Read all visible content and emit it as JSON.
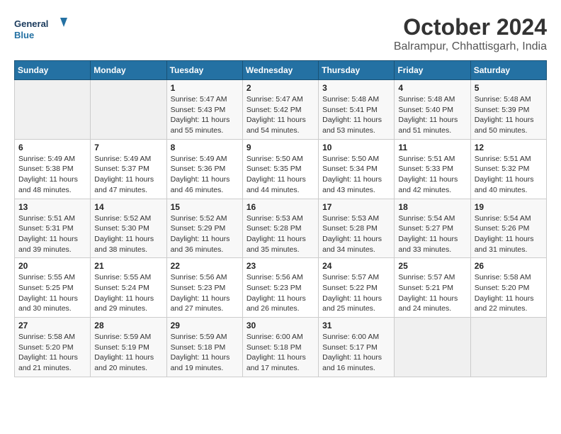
{
  "header": {
    "logo_line1": "General",
    "logo_line2": "Blue",
    "month": "October 2024",
    "location": "Balrampur, Chhattisgarh, India"
  },
  "weekdays": [
    "Sunday",
    "Monday",
    "Tuesday",
    "Wednesday",
    "Thursday",
    "Friday",
    "Saturday"
  ],
  "weeks": [
    [
      {
        "day": "",
        "info": ""
      },
      {
        "day": "",
        "info": ""
      },
      {
        "day": "1",
        "info": "Sunrise: 5:47 AM\nSunset: 5:43 PM\nDaylight: 11 hours and 55 minutes."
      },
      {
        "day": "2",
        "info": "Sunrise: 5:47 AM\nSunset: 5:42 PM\nDaylight: 11 hours and 54 minutes."
      },
      {
        "day": "3",
        "info": "Sunrise: 5:48 AM\nSunset: 5:41 PM\nDaylight: 11 hours and 53 minutes."
      },
      {
        "day": "4",
        "info": "Sunrise: 5:48 AM\nSunset: 5:40 PM\nDaylight: 11 hours and 51 minutes."
      },
      {
        "day": "5",
        "info": "Sunrise: 5:48 AM\nSunset: 5:39 PM\nDaylight: 11 hours and 50 minutes."
      }
    ],
    [
      {
        "day": "6",
        "info": "Sunrise: 5:49 AM\nSunset: 5:38 PM\nDaylight: 11 hours and 48 minutes."
      },
      {
        "day": "7",
        "info": "Sunrise: 5:49 AM\nSunset: 5:37 PM\nDaylight: 11 hours and 47 minutes."
      },
      {
        "day": "8",
        "info": "Sunrise: 5:49 AM\nSunset: 5:36 PM\nDaylight: 11 hours and 46 minutes."
      },
      {
        "day": "9",
        "info": "Sunrise: 5:50 AM\nSunset: 5:35 PM\nDaylight: 11 hours and 44 minutes."
      },
      {
        "day": "10",
        "info": "Sunrise: 5:50 AM\nSunset: 5:34 PM\nDaylight: 11 hours and 43 minutes."
      },
      {
        "day": "11",
        "info": "Sunrise: 5:51 AM\nSunset: 5:33 PM\nDaylight: 11 hours and 42 minutes."
      },
      {
        "day": "12",
        "info": "Sunrise: 5:51 AM\nSunset: 5:32 PM\nDaylight: 11 hours and 40 minutes."
      }
    ],
    [
      {
        "day": "13",
        "info": "Sunrise: 5:51 AM\nSunset: 5:31 PM\nDaylight: 11 hours and 39 minutes."
      },
      {
        "day": "14",
        "info": "Sunrise: 5:52 AM\nSunset: 5:30 PM\nDaylight: 11 hours and 38 minutes."
      },
      {
        "day": "15",
        "info": "Sunrise: 5:52 AM\nSunset: 5:29 PM\nDaylight: 11 hours and 36 minutes."
      },
      {
        "day": "16",
        "info": "Sunrise: 5:53 AM\nSunset: 5:28 PM\nDaylight: 11 hours and 35 minutes."
      },
      {
        "day": "17",
        "info": "Sunrise: 5:53 AM\nSunset: 5:28 PM\nDaylight: 11 hours and 34 minutes."
      },
      {
        "day": "18",
        "info": "Sunrise: 5:54 AM\nSunset: 5:27 PM\nDaylight: 11 hours and 33 minutes."
      },
      {
        "day": "19",
        "info": "Sunrise: 5:54 AM\nSunset: 5:26 PM\nDaylight: 11 hours and 31 minutes."
      }
    ],
    [
      {
        "day": "20",
        "info": "Sunrise: 5:55 AM\nSunset: 5:25 PM\nDaylight: 11 hours and 30 minutes."
      },
      {
        "day": "21",
        "info": "Sunrise: 5:55 AM\nSunset: 5:24 PM\nDaylight: 11 hours and 29 minutes."
      },
      {
        "day": "22",
        "info": "Sunrise: 5:56 AM\nSunset: 5:23 PM\nDaylight: 11 hours and 27 minutes."
      },
      {
        "day": "23",
        "info": "Sunrise: 5:56 AM\nSunset: 5:23 PM\nDaylight: 11 hours and 26 minutes."
      },
      {
        "day": "24",
        "info": "Sunrise: 5:57 AM\nSunset: 5:22 PM\nDaylight: 11 hours and 25 minutes."
      },
      {
        "day": "25",
        "info": "Sunrise: 5:57 AM\nSunset: 5:21 PM\nDaylight: 11 hours and 24 minutes."
      },
      {
        "day": "26",
        "info": "Sunrise: 5:58 AM\nSunset: 5:20 PM\nDaylight: 11 hours and 22 minutes."
      }
    ],
    [
      {
        "day": "27",
        "info": "Sunrise: 5:58 AM\nSunset: 5:20 PM\nDaylight: 11 hours and 21 minutes."
      },
      {
        "day": "28",
        "info": "Sunrise: 5:59 AM\nSunset: 5:19 PM\nDaylight: 11 hours and 20 minutes."
      },
      {
        "day": "29",
        "info": "Sunrise: 5:59 AM\nSunset: 5:18 PM\nDaylight: 11 hours and 19 minutes."
      },
      {
        "day": "30",
        "info": "Sunrise: 6:00 AM\nSunset: 5:18 PM\nDaylight: 11 hours and 17 minutes."
      },
      {
        "day": "31",
        "info": "Sunrise: 6:00 AM\nSunset: 5:17 PM\nDaylight: 11 hours and 16 minutes."
      },
      {
        "day": "",
        "info": ""
      },
      {
        "day": "",
        "info": ""
      }
    ]
  ]
}
